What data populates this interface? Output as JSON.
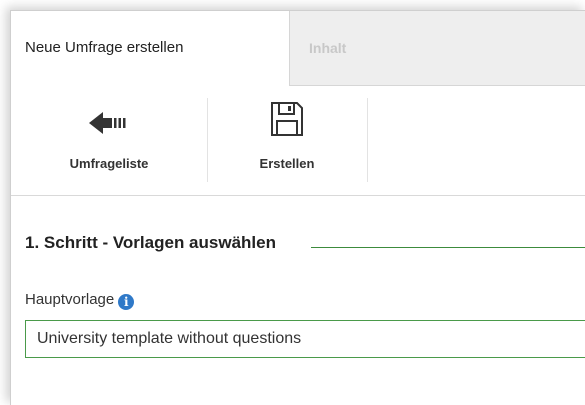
{
  "tabs": [
    {
      "label": "Neue Umfrage erstellen",
      "active": true
    },
    {
      "label": "Inhalt",
      "active": false
    }
  ],
  "toolbar": {
    "list_label": "Umfrageliste",
    "list_icon": "arrow-left-icon",
    "create_label": "Erstellen",
    "create_icon": "floppy-disk-icon"
  },
  "section": {
    "title": "1. Schritt - Vorlagen auswählen",
    "line_color": "#3c8b3c"
  },
  "field": {
    "label": "Hauptvorlage",
    "info_icon": "info-icon",
    "value": "University template without questions",
    "border_color": "#4a9a4a"
  }
}
